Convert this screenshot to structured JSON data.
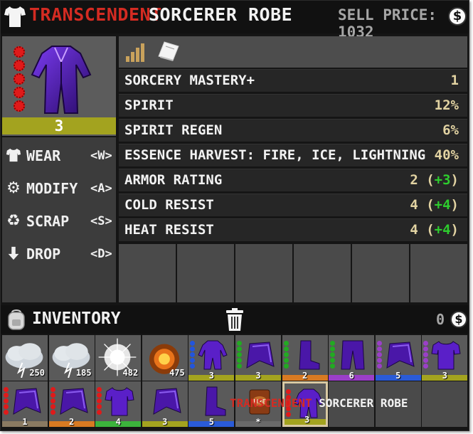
{
  "title": {
    "quality": "TRANSCENDENT",
    "name": "SORCERER ROBE",
    "sell_price_label": "SELL PRICE:",
    "sell_price": "1032",
    "coin_symbol": "$"
  },
  "preview": {
    "item_icon": "purple-robe-icon",
    "mod_slots": 5,
    "count": "3",
    "quality_color": "#a3a31f"
  },
  "actions": [
    {
      "icon": "shirt-icon",
      "label": "WEAR",
      "key": "<W>"
    },
    {
      "icon": "gears-icon",
      "label": "MODIFY",
      "key": "<A>"
    },
    {
      "icon": "recycle-icon",
      "label": "SCRAP",
      "key": "<S>"
    },
    {
      "icon": "arrow-down-icon",
      "label": "DROP",
      "key": "<D>"
    }
  ],
  "stat_header": {
    "icons": [
      "signal-bars-icon",
      "book-icon"
    ]
  },
  "stats": [
    {
      "name": "SORCERY MASTERY+",
      "value": "1",
      "bonus": ""
    },
    {
      "name": "SPIRIT",
      "value": "12%",
      "bonus": ""
    },
    {
      "name": "SPIRIT REGEN",
      "value": "6%",
      "bonus": ""
    },
    {
      "name": "ESSENCE HARVEST: FIRE, ICE, LIGHTNING",
      "value": "40%",
      "bonus": ""
    },
    {
      "name": "ARMOR RATING",
      "value": "2 (",
      "bonus": "+3",
      "close": ")"
    },
    {
      "name": "COLD RESIST",
      "value": "4 (",
      "bonus": "+4",
      "close": ")"
    },
    {
      "name": "HEAT RESIST",
      "value": "4 (",
      "bonus": "+4",
      "close": ")"
    }
  ],
  "inventory": {
    "title": "INVENTORY",
    "money": "0",
    "coin_symbol": "$",
    "row1": [
      {
        "icon": "storm-cloud-icon",
        "count": "250"
      },
      {
        "icon": "storm-cloud-icon",
        "count": "185"
      },
      {
        "icon": "frost-burst-icon",
        "count": "482"
      },
      {
        "icon": "fire-burst-icon",
        "count": "475"
      },
      {
        "icon": "purple-robe-icon",
        "count": "3",
        "bar_color": "#a3a31f",
        "dots_color": "#2255dd"
      },
      {
        "icon": "purple-cape-icon",
        "count": "3",
        "bar_color": "#a3a31f",
        "dots_color": "#22aa22"
      },
      {
        "icon": "purple-boots-icon",
        "count": "2",
        "bar_color": "#d87a22",
        "dots_color": "#22aa22"
      },
      {
        "icon": "purple-pants-icon",
        "count": "6",
        "bar_color": "#9b3fc8",
        "dots_color": "#22aa22"
      },
      {
        "icon": "purple-cape-icon",
        "count": "5",
        "bar_color": "#2a5bd8",
        "dots_color": "#9b3fc8"
      },
      {
        "icon": "purple-shirt-icon",
        "count": "3",
        "bar_color": "#a3a31f",
        "dots_color": "#9b3fc8"
      }
    ],
    "row2": [
      {
        "icon": "purple-cape-icon",
        "count": "1",
        "bar_color": "#8a7a62",
        "dots_color": "#e01a1a"
      },
      {
        "icon": "purple-cape-icon",
        "count": "2",
        "bar_color": "#d87a22",
        "dots_color": "#e01a1a"
      },
      {
        "icon": "purple-shirt-icon",
        "count": "4",
        "bar_color": "#3cb43c",
        "dots_color": "#e01a1a"
      },
      {
        "icon": "purple-cape-icon",
        "count": "3",
        "bar_color": "#a3a31f",
        "dots_color": ""
      },
      {
        "icon": "purple-boots-icon",
        "count": "5",
        "bar_color": "#2a5bd8",
        "dots_color": ""
      },
      {
        "icon": "fire-book-icon",
        "count": "*",
        "bar_color": "#6a6a6a",
        "dots_color": ""
      },
      {
        "icon": "purple-robe-icon",
        "count": "3",
        "bar_color": "#a3a31f",
        "dots_color": "#e01a1a",
        "selected": true
      }
    ],
    "drag_label_quality": "TRANSCENDENT",
    "drag_label_name": "SORCERER ROBE"
  },
  "colors": {
    "quality_red": "#d42b22",
    "bonus_green": "#2ecc2e",
    "value_tan": "#e2d3a2"
  }
}
